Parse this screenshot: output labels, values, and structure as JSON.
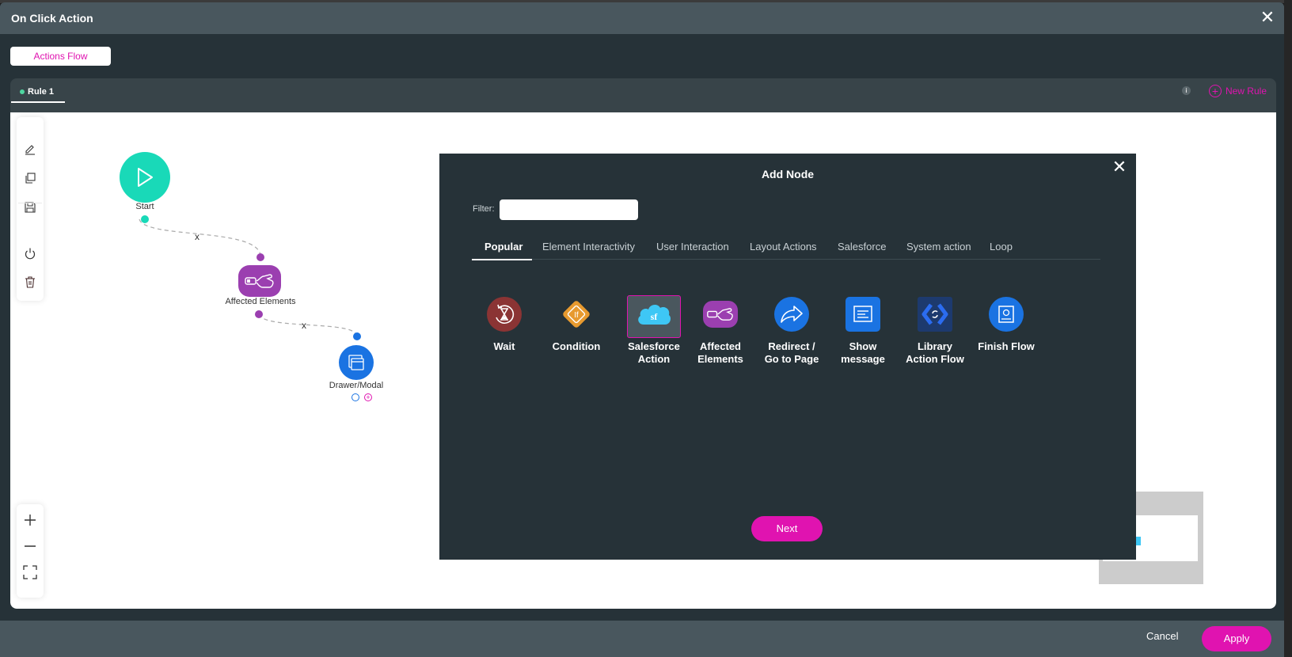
{
  "window": {
    "title": "On Click Action",
    "close_icon": "close-icon"
  },
  "mode_tab": {
    "label": "Actions Flow"
  },
  "rules": {
    "tabs": [
      {
        "label": "Rule 1",
        "active": true
      }
    ],
    "info_icon": "info-icon",
    "new_rule_label": "New Rule"
  },
  "toolbar": {
    "items": [
      "edit-icon",
      "copy-icon",
      "save-icon",
      "power-icon",
      "trash-icon"
    ]
  },
  "zoom_controls": {
    "items": [
      "zoom-in-icon",
      "zoom-out-icon",
      "fit-screen-icon"
    ]
  },
  "flow": {
    "nodes": [
      {
        "label": "Start",
        "color": "#19d9b8",
        "icon": "play-icon"
      },
      {
        "label": "Affected Elements",
        "color": "#9b3fb0",
        "icon": "hand-tap-icon"
      },
      {
        "label": "Drawer/Modal",
        "color": "#1a73e2",
        "icon": "window-icon"
      }
    ],
    "edges": [
      {
        "from": "Start",
        "to": "Affected Elements",
        "delete_label": "x"
      },
      {
        "from": "Affected Elements",
        "to": "Drawer/Modal",
        "delete_label": "x"
      }
    ]
  },
  "add_node": {
    "title": "Add Node",
    "filter": {
      "label": "Filter:",
      "value": "",
      "placeholder": ""
    },
    "tabs": [
      {
        "label": "Popular",
        "active": true
      },
      {
        "label": "Element Interactivity"
      },
      {
        "label": "User Interaction"
      },
      {
        "label": "Layout Actions"
      },
      {
        "label": "Salesforce"
      },
      {
        "label": "System action"
      },
      {
        "label": "Loop"
      }
    ],
    "nodes": [
      {
        "label": "Wait",
        "icon": "hourglass-icon",
        "color": "#8b3434"
      },
      {
        "label": "Condition",
        "icon": "if-diamond-icon",
        "color": "#e79a2f"
      },
      {
        "label": "Salesforce Action",
        "icon": "salesforce-cloud-icon",
        "color": "#3ec7f5",
        "selected": true
      },
      {
        "label": "Affected Elements",
        "icon": "hand-tap-icon",
        "color": "#9b3fb0"
      },
      {
        "label": "Redirect / Go to Page",
        "icon": "share-arrow-icon",
        "color": "#1a73e2"
      },
      {
        "label": "Show message",
        "icon": "message-icon",
        "color": "#1a73e2"
      },
      {
        "label": "Library Action Flow",
        "icon": "library-code-icon",
        "color": "#1d3a6e"
      },
      {
        "label": "Finish Flow",
        "icon": "finish-icon",
        "color": "#1a73e2"
      }
    ],
    "next_label": "Next"
  },
  "footer": {
    "cancel_label": "Cancel",
    "apply_label": "Apply"
  },
  "colors": {
    "accent": "#e013b0",
    "header": "#49575e",
    "dark_bg": "#263238"
  }
}
